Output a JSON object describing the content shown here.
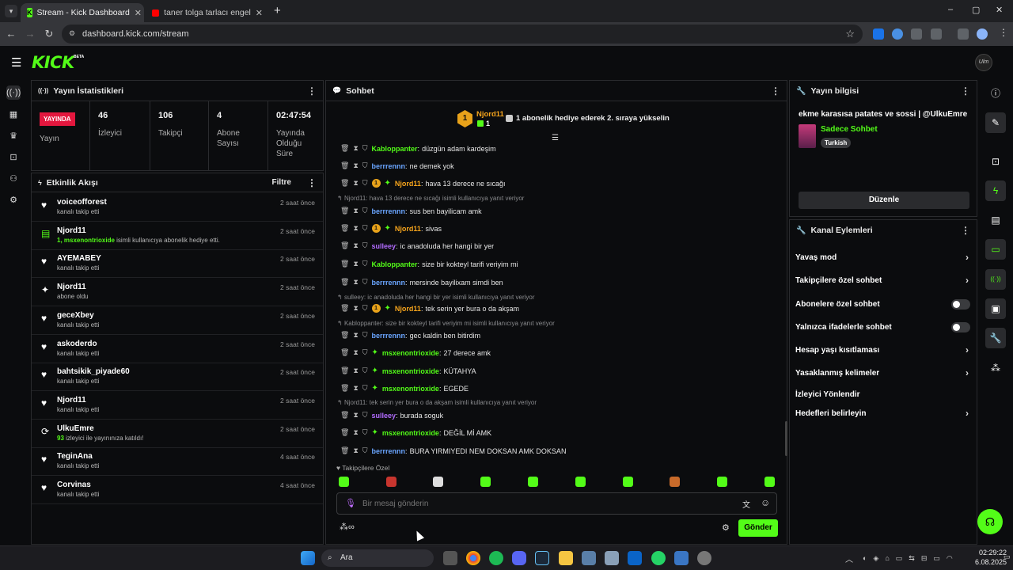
{
  "browser": {
    "tabs": [
      {
        "label": "Stream - Kick Dashboard",
        "active": true
      },
      {
        "label": "taner tolga tarlacı engelli hayra",
        "active": false
      }
    ],
    "new_tab": "+",
    "url": "dashboard.kick.com/stream",
    "window_controls": [
      "–",
      "▢",
      "✕"
    ]
  },
  "header": {
    "logo": "KICK",
    "beta": "BETA",
    "avatar_initials": "Ulm"
  },
  "stats_panel": {
    "title": "Yayın İstatistikleri",
    "live_badge": "YAYINDA",
    "live_label": "Yayın",
    "items": [
      {
        "value": "46",
        "label": "İzleyici"
      },
      {
        "value": "106",
        "label": "Takipçi"
      },
      {
        "value": "4",
        "label": "Abone Sayısı"
      },
      {
        "value": "02:47:54",
        "label": "Yayında Olduğu Süre"
      }
    ]
  },
  "activity": {
    "title": "Etkinlik Akışı",
    "filter": "Filtre",
    "rows": [
      {
        "name": "voiceofforest",
        "sub": "kanalı takip etti",
        "time": "2 saat önce",
        "icon": "heart-icon"
      },
      {
        "name": "Njord11",
        "sub_hl": "1, msxenontrioxide",
        "sub": " isimli kullanıcıya abonelik hediye etti.",
        "time": "2 saat önce",
        "icon": "gift-icon"
      },
      {
        "name": "AYEMABEY",
        "sub": "kanalı takip etti",
        "time": "2 saat önce",
        "icon": "heart-icon"
      },
      {
        "name": "Njord11",
        "sub": "abone oldu",
        "time": "2 saat önce",
        "icon": "star-icon"
      },
      {
        "name": "geceXbey",
        "sub": "kanalı takip etti",
        "time": "2 saat önce",
        "icon": "heart-icon"
      },
      {
        "name": "askoderdo",
        "sub": "kanalı takip etti",
        "time": "2 saat önce",
        "icon": "heart-icon"
      },
      {
        "name": "bahtsikik_piyade60",
        "sub": "kanalı takip etti",
        "time": "2 saat önce",
        "icon": "heart-icon"
      },
      {
        "name": "Njord11",
        "sub": "kanalı takip etti",
        "time": "2 saat önce",
        "icon": "heart-icon"
      },
      {
        "name": "UlkuEmre",
        "sub_hl": "93",
        "sub": " izleyici ile yayınınıza katıldı!",
        "time": "2 saat önce",
        "icon": "raid-icon"
      },
      {
        "name": "TeginAna",
        "sub": "kanalı takip etti",
        "time": "4 saat önce",
        "icon": "heart-icon"
      },
      {
        "name": "Corvinas",
        "sub": "kanalı takip etti",
        "time": "4 saat önce",
        "icon": "heart-icon"
      }
    ]
  },
  "chat": {
    "title": "Sohbet",
    "pinned_user": "Njord11",
    "pinned_rank": "1",
    "pinned_count": "1",
    "pinned_text": "1 abonelik hediye ederek 2. sıraya yükselin",
    "messages": [
      {
        "user": "Kabloppanter",
        "color": "#53fc18",
        "text": "düzgün adam kardeşim",
        "badges": false
      },
      {
        "user": "berrrennn",
        "color": "#6aa5ff",
        "text": "ne demek yok",
        "badges": false
      },
      {
        "user": "Njord11",
        "color": "#f7a51c",
        "text": "hava 13 derece ne sıcağı",
        "badges": true
      },
      {
        "reply": "Njord11: hava 13 derece ne sıcağı isimli kullanıcıya yanıt veriyor"
      },
      {
        "user": "berrrennn",
        "color": "#6aa5ff",
        "text": "sus ben bayilicam amk",
        "badges": false
      },
      {
        "user": "Njord11",
        "color": "#f7a51c",
        "text": "sivas",
        "badges": true
      },
      {
        "user": "sulleey",
        "color": "#b26cff",
        "text": "ic anadoluda her hangi bir yer",
        "badges": false
      },
      {
        "user": "Kabloppanter",
        "color": "#53fc18",
        "text": "size bir kokteyl tarifi veriyim mi",
        "badges": false
      },
      {
        "user": "berrrennn",
        "color": "#6aa5ff",
        "text": "mersinde bayilixam simdi ben",
        "badges": false
      },
      {
        "reply": "sulleey: ic anadoluda her hangi bir yer isimli kullanıcıya yanıt veriyor"
      },
      {
        "user": "Njord11",
        "color": "#f7a51c",
        "text": "tek serin yer bura o da akşam",
        "badges": true
      },
      {
        "reply": "Kabloppanter: size bir kokteyl tarifi veriyim mi isimli kullanıcıya yanıt veriyor"
      },
      {
        "user": "berrrennn",
        "color": "#6aa5ff",
        "text": "gec kaldin ben bitirdim",
        "badges": false
      },
      {
        "user": "msxenontrioxide",
        "color": "#53fc18",
        "text": "27 derece amk",
        "badges": "sub"
      },
      {
        "user": "msxenontrioxide",
        "color": "#53fc18",
        "text": "KÜTAHYA",
        "badges": "sub"
      },
      {
        "user": "msxenontrioxide",
        "color": "#53fc18",
        "text": "EGEDE",
        "badges": "sub"
      },
      {
        "reply": "Njord11: tek serin yer bura o da akşam isimli kullanıcıya yanıt veriyor"
      },
      {
        "user": "sulleey",
        "color": "#b26cff",
        "text": "burada soguk",
        "badges": false
      },
      {
        "user": "msxenontrioxide",
        "color": "#53fc18",
        "text": "DEĞİL Mİ AMK",
        "badges": "sub"
      },
      {
        "user": "berrrennn",
        "color": "#6aa5ff",
        "text": "BURA YIRMIYEDI NEM DOKSAN AMK DOKSAN",
        "badges": false
      }
    ],
    "emote_label": "Takipçilere Özel",
    "input_placeholder": "Bir mesaj gönderin",
    "send": "Gönder"
  },
  "stream_info": {
    "title": "Yayın bilgisi",
    "stream_title": "ekme karasısa patates ve sossi | @UlkuEmre",
    "category": "Sadece Sohbet",
    "tag": "Turkish",
    "edit": "Düzenle"
  },
  "channel_actions": {
    "title": "Kanal Eylemleri",
    "items": [
      {
        "label": "Yavaş mod",
        "type": "chevron"
      },
      {
        "label": "Takipçilere özel sohbet",
        "type": "chevron"
      },
      {
        "label": "Abonelere özel sohbet",
        "type": "toggle"
      },
      {
        "label": "Yalnızca ifadelerle sohbet",
        "type": "toggle"
      },
      {
        "label": "Hesap yaşı kısıtlaması",
        "type": "chevron"
      },
      {
        "label": "Yasaklanmış kelimeler",
        "type": "chevron"
      },
      {
        "label": "İzleyici Yönlendir",
        "type": "none"
      },
      {
        "label": "Hedefleri belirleyin",
        "type": "chevron"
      }
    ]
  },
  "taskbar": {
    "search": "Ara",
    "time": "02:29:22",
    "date": "6.08.2025"
  },
  "colors": {
    "brand": "#53fc18",
    "live": "#e3173e",
    "bg": "#0b0c0e"
  }
}
